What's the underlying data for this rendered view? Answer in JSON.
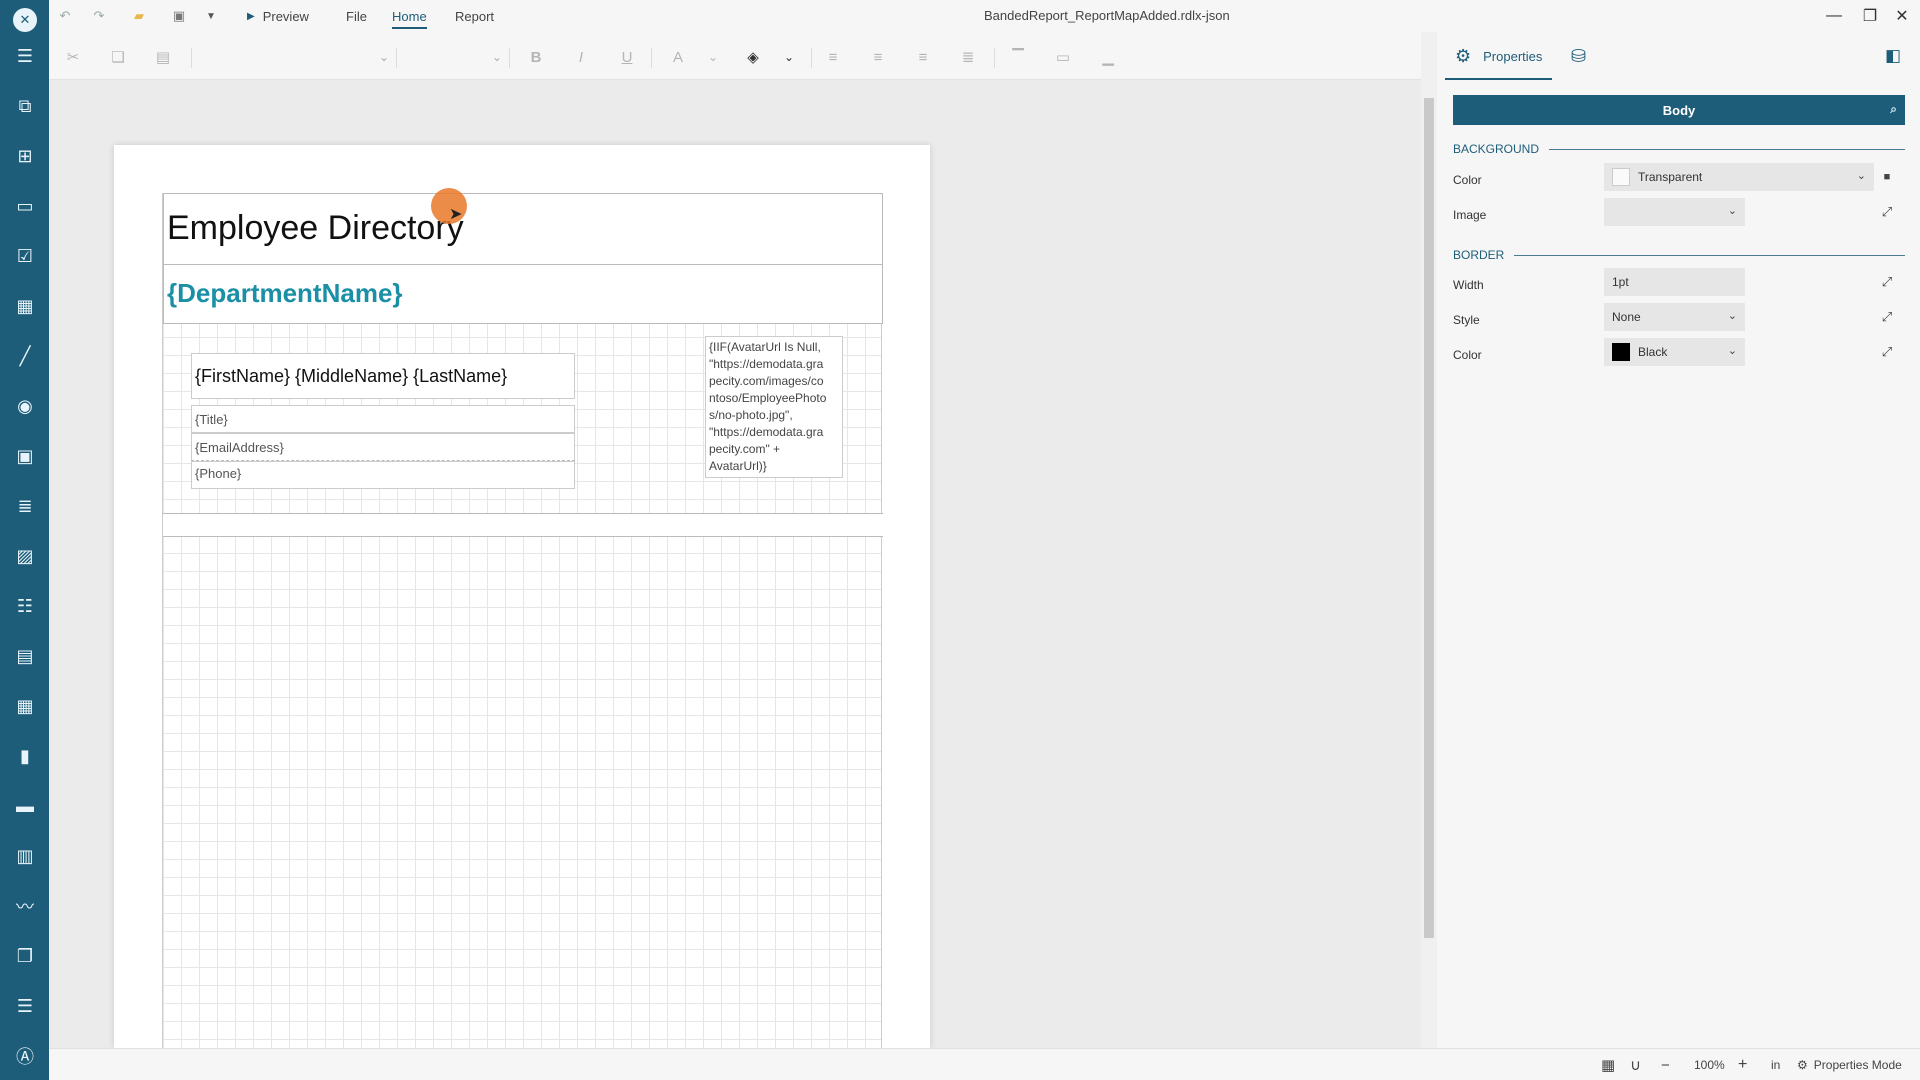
{
  "app": {
    "logo_glyph": "✕",
    "doc_title": "BandedReport_ReportMapAdded.rdlx-json"
  },
  "menu": {
    "preview_label": "Preview",
    "file_label": "File",
    "home_label": "Home",
    "report_label": "Report"
  },
  "sidebar": {
    "items": [
      {
        "name": "menu-icon",
        "glyph": "☰"
      },
      {
        "name": "data-tree-icon",
        "glyph": "⧉"
      },
      {
        "name": "report-explorer-icon",
        "glyph": "⊞"
      },
      {
        "name": "textbox-tool-icon",
        "glyph": "▭"
      },
      {
        "name": "checkbox-tool-icon",
        "glyph": "☑"
      },
      {
        "name": "container-tool-icon",
        "glyph": "▦"
      },
      {
        "name": "line-tool-icon",
        "glyph": "╱"
      },
      {
        "name": "shape-tool-icon",
        "glyph": "◉"
      },
      {
        "name": "formatted-text-tool-icon",
        "glyph": "▣"
      },
      {
        "name": "richtext-tool-icon",
        "glyph": "≣"
      },
      {
        "name": "image-tool-icon",
        "glyph": "▨"
      },
      {
        "name": "list-tool-icon",
        "glyph": "☷"
      },
      {
        "name": "table-tool-icon",
        "glyph": "▤"
      },
      {
        "name": "tablix-tool-icon",
        "glyph": "▦"
      },
      {
        "name": "chart-tool-icon",
        "glyph": "▮"
      },
      {
        "name": "bullet-tool-icon",
        "glyph": "▬"
      },
      {
        "name": "barcode-tool-icon",
        "glyph": "▥"
      },
      {
        "name": "sparkline-tool-icon",
        "glyph": "〰"
      },
      {
        "name": "subreport-tool-icon",
        "glyph": "❐"
      },
      {
        "name": "banded-list-tool-icon",
        "glyph": "☰"
      },
      {
        "name": "input-field-tool-icon",
        "glyph": "Ⓐ"
      }
    ]
  },
  "report": {
    "title": "Employee Directory",
    "group_header": "{DepartmentName}",
    "full_name": "{FirstName} {MiddleName} {LastName}",
    "job_title": "{Title}",
    "email": "{EmailAddress}",
    "phone": "{Phone}",
    "avatar_expression": "{IIF(AvatarUrl Is Null,\n\"https://demodata.gra\npecity.com/images/co\nntoso/EmployeePhoto\ns/no-photo.jpg\",\n\"https://demodata.gra\npecity.com\" +\nAvatarUrl)}"
  },
  "properties": {
    "tab_label": "Properties",
    "selected_item": "Body",
    "background_section": "BACKGROUND",
    "border_section": "BORDER",
    "bg_color_label": "Color",
    "bg_color_value": "Transparent",
    "image_label": "Image",
    "image_value": "",
    "width_label": "Width",
    "width_value": "1pt",
    "style_label": "Style",
    "style_value": "None",
    "border_color_label": "Color",
    "border_color_value": "Black"
  },
  "status": {
    "zoom": "100%",
    "unit": "in",
    "mode": "Properties Mode"
  },
  "colors": {
    "accent": "#1e5d7a",
    "group_header_text": "#1a8fa6",
    "cursor": "#e87828"
  }
}
